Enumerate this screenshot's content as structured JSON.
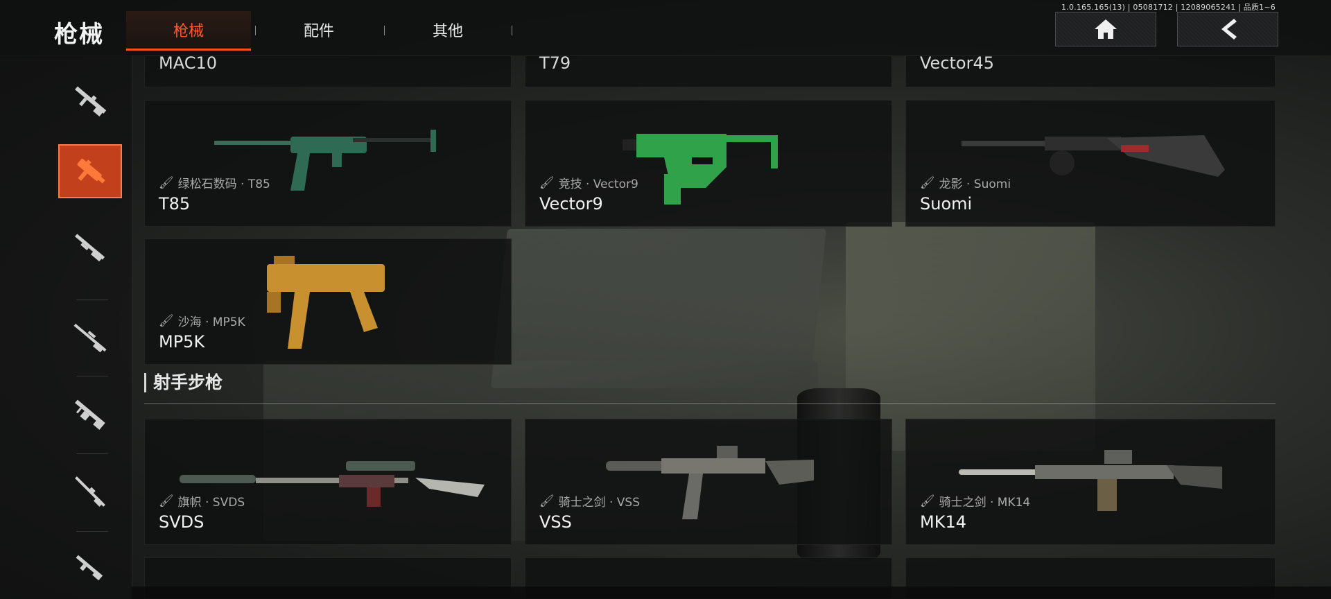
{
  "header": {
    "title": "枪械",
    "tabs": [
      {
        "label": "枪械",
        "active": true
      },
      {
        "label": "配件",
        "active": false
      },
      {
        "label": "其他",
        "active": false
      }
    ],
    "version": "1.0.165.165(13) | 05081712 | 12089065241 | 品质1~6",
    "home_icon": "home-icon",
    "back_icon": "chevron-left-icon"
  },
  "sidebar": {
    "items": [
      {
        "icon": "assault-rifle-icon",
        "active": false
      },
      {
        "icon": "smg-icon",
        "active": true
      },
      {
        "icon": "shotgun-icon",
        "active": false
      },
      {
        "icon": "sniper-rifle-icon",
        "active": false
      },
      {
        "icon": "lmg-icon",
        "active": false
      },
      {
        "icon": "marksman-rifle-icon",
        "active": false
      },
      {
        "icon": "pistol-icon",
        "active": false
      }
    ]
  },
  "cut_row": {
    "items": [
      {
        "name": "MAC10"
      },
      {
        "name": "T79"
      },
      {
        "name": "Vector45"
      }
    ]
  },
  "smg_section": {
    "items": [
      {
        "skin": "绿松石数码 · T85",
        "name": "T85",
        "color": "#2f6a55"
      },
      {
        "skin": "竞技 · Vector9",
        "name": "Vector9",
        "color": "#2fa24a"
      },
      {
        "skin": "龙影 · Suomi",
        "name": "Suomi",
        "color": "#3a3a3a"
      },
      {
        "skin": "沙海 · MP5K",
        "name": "MP5K",
        "color": "#c8902e"
      }
    ]
  },
  "marksman_section": {
    "title": "射手步枪",
    "items": [
      {
        "skin": "旗帜 · SVDS",
        "name": "SVDS",
        "color": "#4c5a52"
      },
      {
        "skin": "骑士之剑 · VSS",
        "name": "VSS",
        "color": "#6a6a66"
      },
      {
        "skin": "骑士之剑 · MK14",
        "name": "MK14",
        "color": "#5e605c"
      }
    ]
  },
  "colors": {
    "accent": "#ff4d1f",
    "active_bg": "#c2401b"
  }
}
